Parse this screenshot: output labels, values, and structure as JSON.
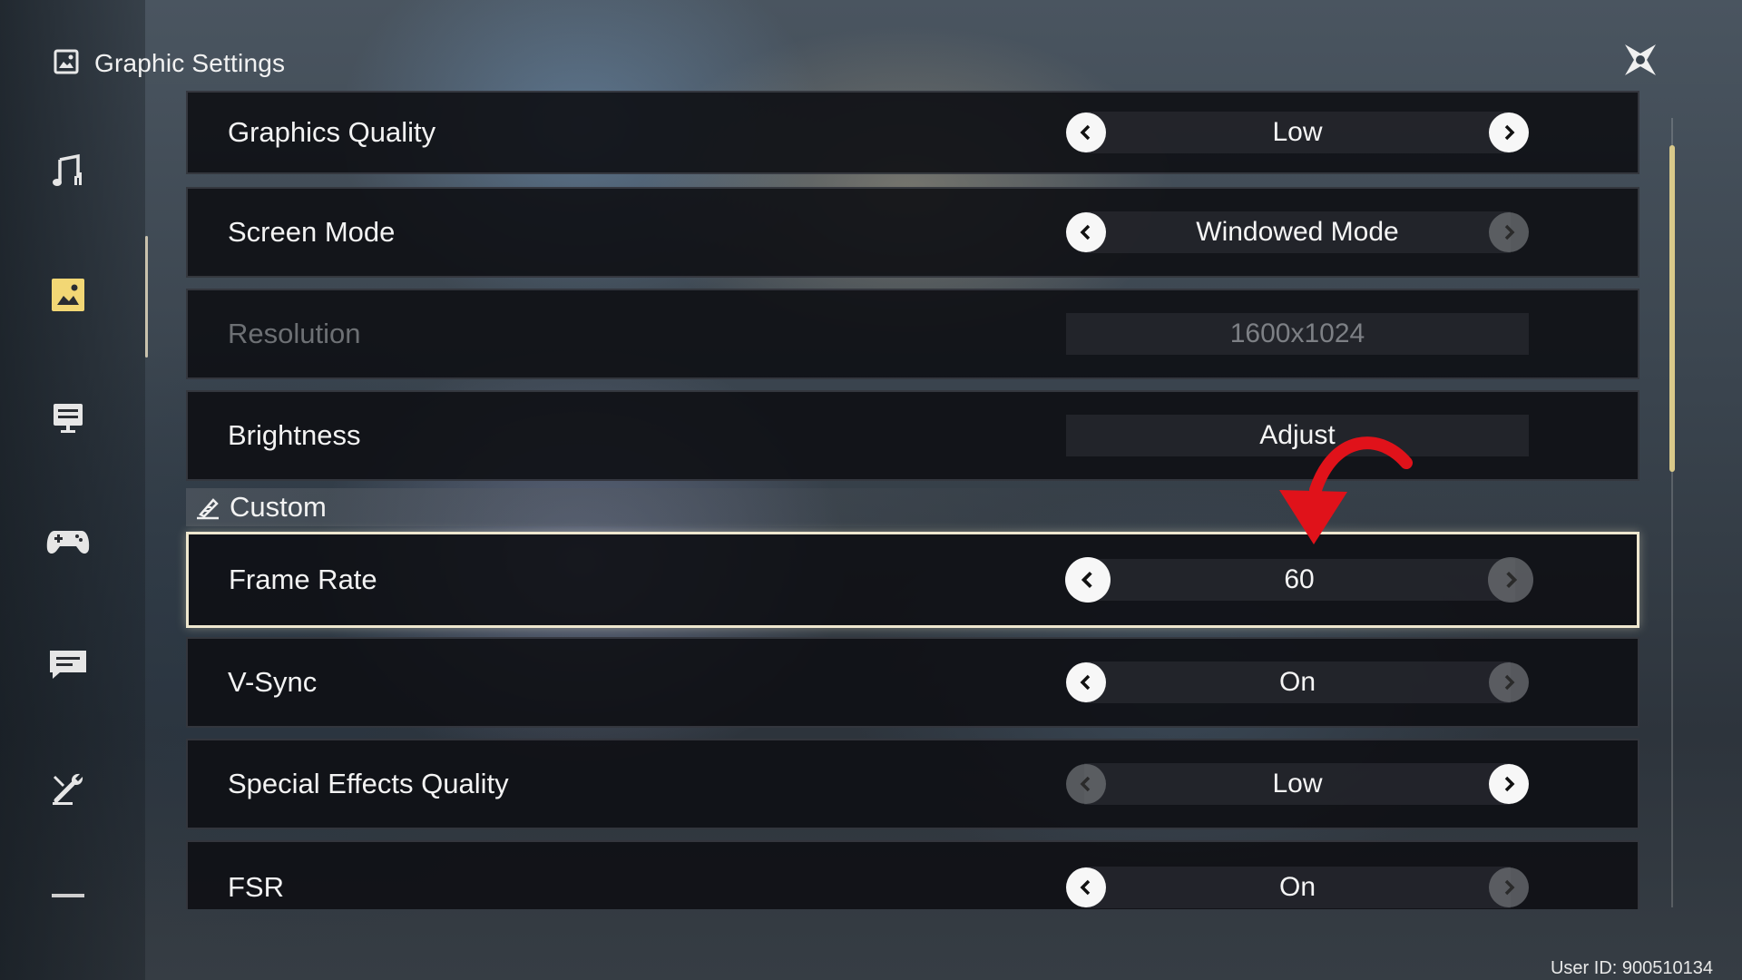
{
  "header": {
    "title": "Graphic Settings",
    "icon": "image-settings-icon"
  },
  "close": {
    "icon": "close-star-icon"
  },
  "sidebar": {
    "items": [
      {
        "name": "audio",
        "icon": "music-note-icon",
        "active": false
      },
      {
        "name": "graphics",
        "icon": "image-icon",
        "active": true
      },
      {
        "name": "display",
        "icon": "monitor-icon",
        "active": false
      },
      {
        "name": "controls",
        "icon": "gamepad-icon",
        "active": false
      },
      {
        "name": "chat",
        "icon": "chat-bubble-icon",
        "active": false
      },
      {
        "name": "other",
        "icon": "wrench-icon",
        "active": false
      },
      {
        "name": "more",
        "icon": "dash-icon",
        "active": false
      }
    ]
  },
  "settings": {
    "graphics_quality": {
      "label": "Graphics Quality",
      "value": "Low"
    },
    "screen_mode": {
      "label": "Screen Mode",
      "value": "Windowed Mode"
    },
    "resolution": {
      "label": "Resolution",
      "value": "1600x1024"
    },
    "brightness": {
      "label": "Brightness",
      "value": "Adjust"
    },
    "custom": {
      "label": "Custom",
      "icon": "pen-icon"
    },
    "frame_rate": {
      "label": "Frame Rate",
      "value": "60"
    },
    "vsync": {
      "label": "V-Sync",
      "value": "On"
    },
    "special_effects": {
      "label": "Special Effects Quality",
      "value": "Low"
    },
    "fsr": {
      "label": "FSR",
      "value": "On"
    }
  },
  "annotation": {
    "arrow_color": "#e0121a"
  },
  "colors": {
    "accent": "#d9c98a",
    "selected_border": "#eee7cf"
  },
  "footer": {
    "user_id": "User ID: 900510134"
  }
}
